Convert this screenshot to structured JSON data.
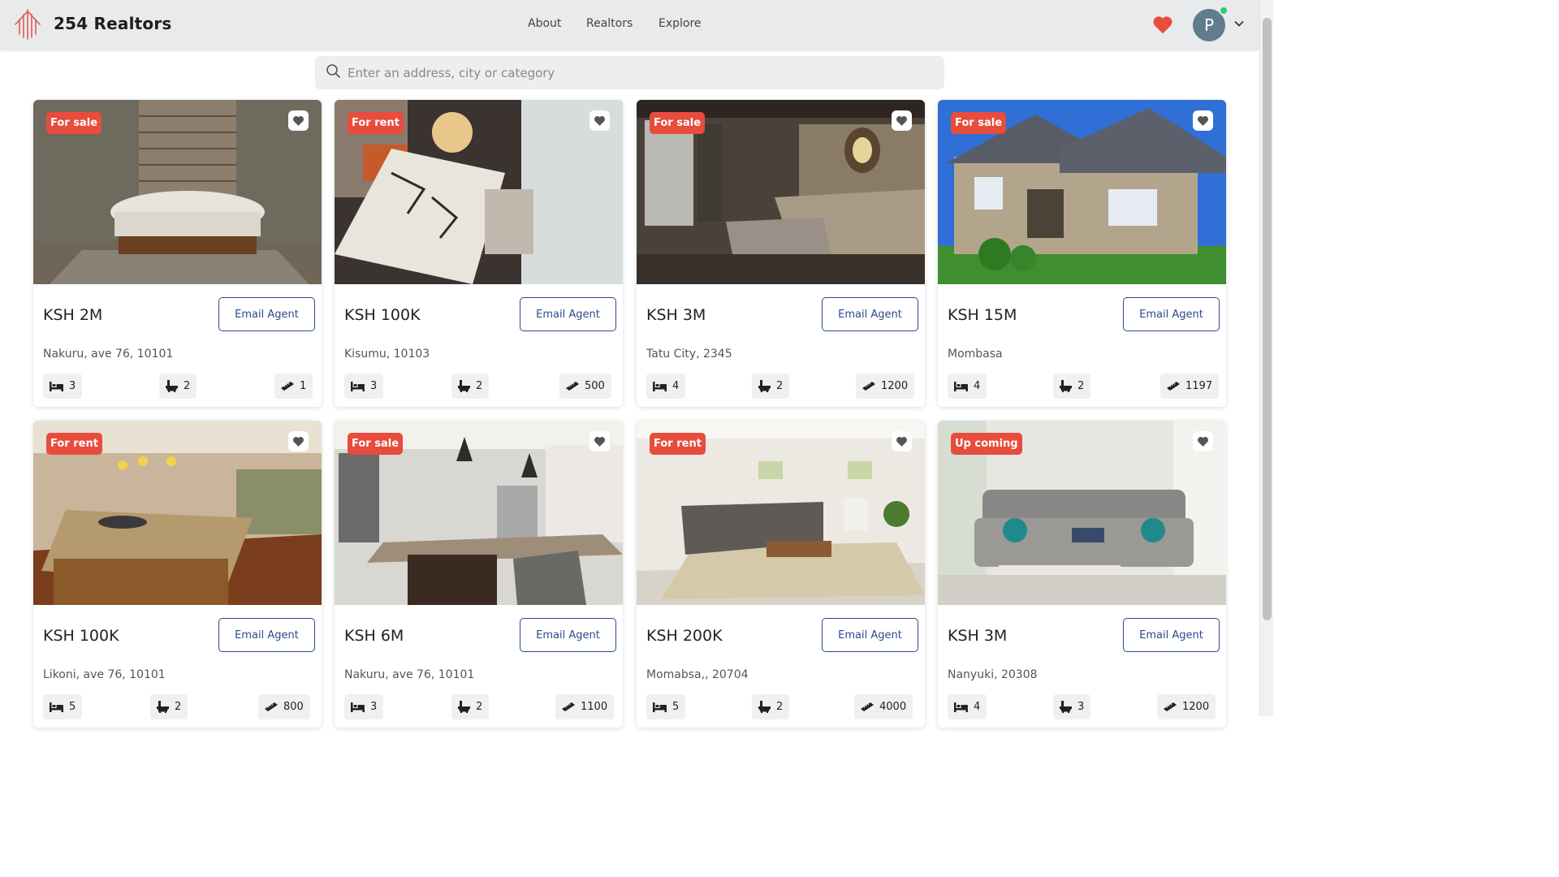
{
  "header": {
    "brand": "254 Realtors",
    "nav": [
      "About",
      "Realtors",
      "Explore"
    ],
    "avatar_letter": "P"
  },
  "search": {
    "placeholder": "Enter an address, city or category"
  },
  "colors": {
    "accent_red": "#e74c3c",
    "link_blue": "#2a4a8c",
    "header_bg": "#e9eaeb"
  },
  "listings": [
    {
      "status": "For sale",
      "price": "KSH 2M",
      "button": "Email Agent",
      "address": "Nakuru, ave 76, 10101",
      "beds": "3",
      "baths": "2",
      "area": "1",
      "photo": "bathroom with freestanding bathtub"
    },
    {
      "status": "For rent",
      "price": "KSH 100K",
      "button": "Email Agent",
      "address": "Kisumu, 10103",
      "beds": "3",
      "baths": "2",
      "area": "500",
      "photo": "living room top view"
    },
    {
      "status": "For sale",
      "price": "KSH 3M",
      "button": "Email Agent",
      "address": "Tatu City, 2345",
      "beds": "4",
      "baths": "2",
      "area": "1200",
      "photo": "bedroom with ornate mirror"
    },
    {
      "status": "For sale",
      "price": "KSH 15M",
      "button": "Email Agent",
      "address": "Mombasa",
      "beds": "4",
      "baths": "2",
      "area": "1197",
      "photo": "two-storey house exterior"
    },
    {
      "status": "For rent",
      "price": "KSH 100K",
      "button": "Email Agent",
      "address": "Likoni, ave 76, 10101",
      "beds": "5",
      "baths": "2",
      "area": "800",
      "photo": "kitchen with granite island"
    },
    {
      "status": "For sale",
      "price": "KSH 6M",
      "button": "Email Agent",
      "address": "Nakuru, ave 76, 10101",
      "beds": "3",
      "baths": "2",
      "area": "1100",
      "photo": "white kitchen with lanterns"
    },
    {
      "status": "For rent",
      "price": "KSH 200K",
      "button": "Email Agent",
      "address": "Momabsa,, 20704",
      "beds": "5",
      "baths": "2",
      "area": "4000",
      "photo": "living room with sectional sofa"
    },
    {
      "status": "Up coming",
      "price": "KSH 3M",
      "button": "Email Agent",
      "address": "Nanyuki, 20308",
      "beds": "4",
      "baths": "3",
      "area": "1200",
      "photo": "grey tufted sofa lounge"
    }
  ]
}
